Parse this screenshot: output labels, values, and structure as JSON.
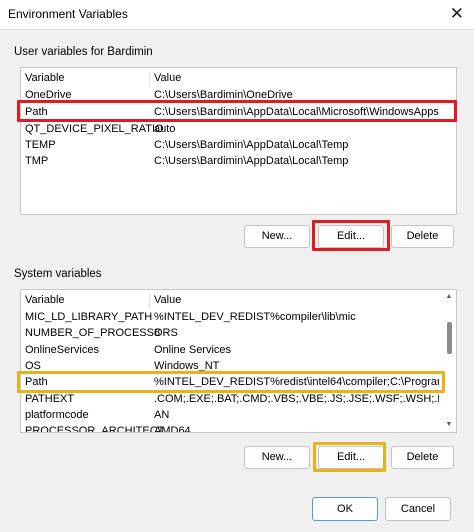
{
  "window": {
    "title": "Environment Variables"
  },
  "user_section": {
    "label": "User variables for Bardimin",
    "columns": [
      "Variable",
      "Value"
    ],
    "rows": [
      {
        "variable": "OneDrive",
        "value": "C:\\Users\\Bardimin\\OneDrive"
      },
      {
        "variable": "Path",
        "value": "C:\\Users\\Bardimin\\AppData\\Local\\Microsoft\\WindowsApps;C..."
      },
      {
        "variable": "QT_DEVICE_PIXEL_RATIO",
        "value": "auto"
      },
      {
        "variable": "TEMP",
        "value": "C:\\Users\\Bardimin\\AppData\\Local\\Temp"
      },
      {
        "variable": "TMP",
        "value": "C:\\Users\\Bardimin\\AppData\\Local\\Temp"
      }
    ],
    "buttons": {
      "new": "New...",
      "edit": "Edit...",
      "delete": "Delete"
    }
  },
  "system_section": {
    "label": "System variables",
    "columns": [
      "Variable",
      "Value"
    ],
    "rows": [
      {
        "variable": "MIC_LD_LIBRARY_PATH",
        "value": "%INTEL_DEV_REDIST%compiler\\lib\\mic"
      },
      {
        "variable": "NUMBER_OF_PROCESSORS",
        "value": "8"
      },
      {
        "variable": "OnlineServices",
        "value": "Online Services"
      },
      {
        "variable": "OS",
        "value": "Windows_NT"
      },
      {
        "variable": "Path",
        "value": "%INTEL_DEV_REDIST%redist\\intel64\\compiler;C:\\Program Fil..."
      },
      {
        "variable": "PATHEXT",
        "value": ".COM;.EXE;.BAT;.CMD;.VBS;.VBE;.JS;.JSE;.WSF;.WSH;.MSC"
      },
      {
        "variable": "platformcode",
        "value": "AN"
      },
      {
        "variable": "PROCESSOR_ARCHITECT",
        "value": "AMD64"
      }
    ],
    "buttons": {
      "new": "New...",
      "edit": "Edit...",
      "delete": "Delete"
    }
  },
  "dialog_buttons": {
    "ok": "OK",
    "cancel": "Cancel"
  },
  "icons": {
    "close": "close-icon"
  },
  "colors": {
    "highlight_user": "#e11b22",
    "highlight_system": "#e8b21a",
    "focus_border": "#5a9bd5"
  }
}
